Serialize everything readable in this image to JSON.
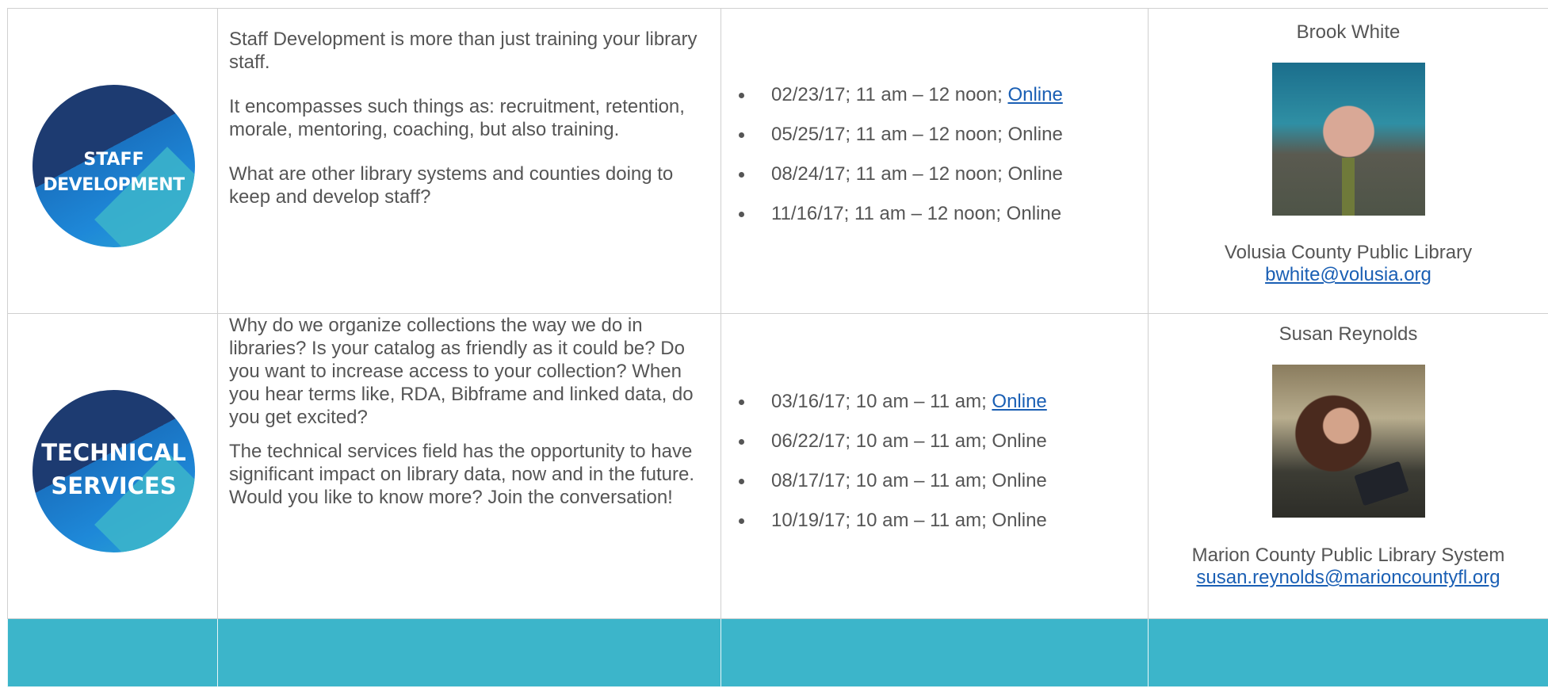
{
  "rows": [
    {
      "logo": {
        "line1": "STAFF",
        "line2": "DEVELOPMENT"
      },
      "description": [
        "Staff Development is more than just training your library staff.",
        "It encompasses such things as: recruitment, retention, morale, mentoring, coaching, but also training.",
        "What are other library systems and counties doing to keep and develop staff?"
      ],
      "dates": [
        {
          "text": "02/23/17; 11 am – 12 noon; ",
          "link": "Online"
        },
        {
          "text": "05/25/17; 11 am – 12 noon; Online"
        },
        {
          "text": "08/24/17; 11 am – 12 noon; Online"
        },
        {
          "text": "11/16/17; 11 am – 12 noon; Online"
        }
      ],
      "presenter": {
        "name": "Brook White",
        "organization": "Volusia County Public Library",
        "email": "bwhite@volusia.org"
      }
    },
    {
      "logo": {
        "line1": "TECHNICAL",
        "line2": "SERVICES"
      },
      "description": [
        "Why do we organize collections the way we do in libraries?  Is your catalog as friendly as it could be?  Do you want to increase access to your collection?  When you hear terms like, RDA, Bibframe and linked data, do you get excited?",
        "The technical services field has the opportunity to have significant impact on library data, now and in the future. Would you like to know more? Join the conversation!"
      ],
      "dates": [
        {
          "text": "03/16/17; 10 am – 11 am; ",
          "link": "Online"
        },
        {
          "text": "06/22/17; 10 am – 11 am; Online"
        },
        {
          "text": "08/17/17; 10 am – 11 am; Online"
        },
        {
          "text": "10/19/17; 10 am – 11 am; Online"
        }
      ],
      "presenter": {
        "name": "Susan Reynolds",
        "organization": "Marion County Public Library System",
        "email": "susan.reynolds@marioncountyfl.org"
      }
    }
  ],
  "colors": {
    "footer_row": "#3cb5ca",
    "link": "#1a5fb4",
    "text": "#555555"
  }
}
